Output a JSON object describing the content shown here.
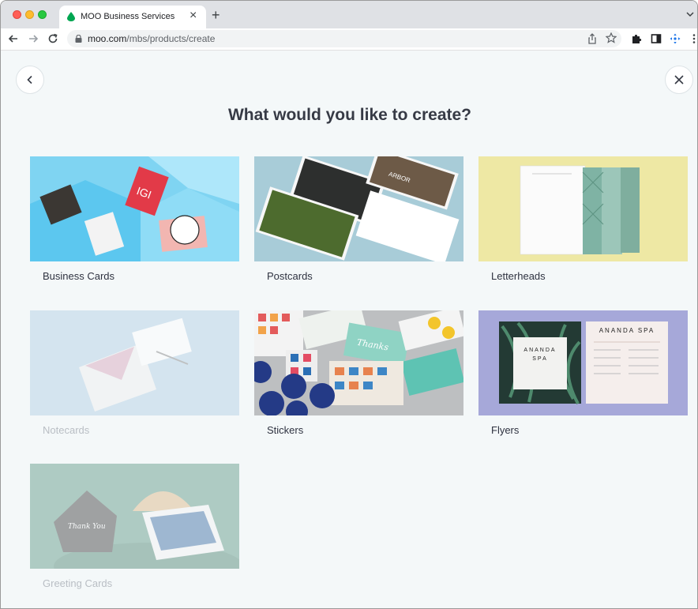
{
  "browser": {
    "tab_title": "MOO Business Services",
    "url_domain": "moo.com",
    "url_path": "/mbs/products/create"
  },
  "page": {
    "heading": "What would you like to create?",
    "products": [
      {
        "label": "Business Cards",
        "enabled": true
      },
      {
        "label": "Postcards",
        "enabled": true
      },
      {
        "label": "Letterheads",
        "enabled": true
      },
      {
        "label": "Notecards",
        "enabled": false
      },
      {
        "label": "Stickers",
        "enabled": true
      },
      {
        "label": "Flyers",
        "enabled": true
      },
      {
        "label": "Greeting Cards",
        "enabled": false
      }
    ]
  },
  "thumbnails": {
    "business_card_tag": "IGI",
    "flyer_title": "ANANDA SPA",
    "flyer_title_2": "ANANDA",
    "flyer_title_3": "SPA",
    "sticker_script": "Thanks",
    "greeting_script": "Thank You",
    "postcard_text": "ARBOR"
  },
  "colors": {
    "page_bg": "#f4f8f9",
    "heading": "#363a45",
    "label": "#2e3240",
    "label_disabled": "#b9bec4"
  }
}
